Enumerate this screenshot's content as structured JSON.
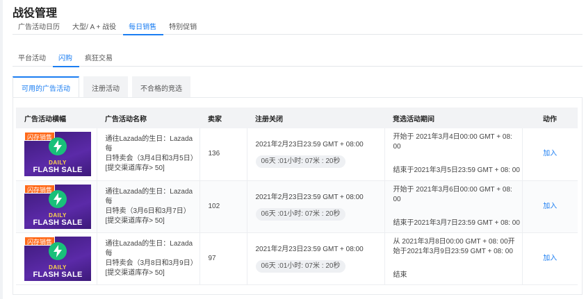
{
  "page": {
    "title": "战役管理"
  },
  "top_tabs": [
    {
      "label": "广告活动日历",
      "active": false
    },
    {
      "label": "大型/ A + 战役",
      "active": false
    },
    {
      "label": "每日销售",
      "active": true
    },
    {
      "label": "特别促销",
      "active": false
    }
  ],
  "sub_tabs": [
    {
      "label": "平台活动",
      "active": false
    },
    {
      "label": "闪购",
      "active": true
    },
    {
      "label": "疯狂交易",
      "active": false
    }
  ],
  "panel_tabs": [
    {
      "label": "可用的广告活动",
      "active": true
    },
    {
      "label": "注册活动",
      "active": false
    },
    {
      "label": "不合格的竞选",
      "active": false
    }
  ],
  "table": {
    "headers": [
      "广告活动横幅",
      "广告活动名称",
      "卖家",
      "注册关闭",
      "竞选活动期间",
      "动作"
    ],
    "banner": {
      "badge": "闪存销售",
      "line1": "DAILY",
      "line2": "FLASH SALE",
      "icon": "lightning-bolt-icon"
    },
    "rows": [
      {
        "name_l1": "通往Lazada的生日：Lazada每",
        "name_l2": "日特卖会（3月4日和3月5日）",
        "name_l3": "[提交渠道库存> 50]",
        "sellers": "136",
        "close": "2021年2月23日23:59 GMT + 08:00",
        "countdown": "06天 :01小时: 07米 : 20秒",
        "p1": "开始于 2021年3月4日00:00 GMT + 08:",
        "p2": "00",
        "p3": "结束于2021年3月5日23:59 GMT + 08:  00",
        "action": "加入"
      },
      {
        "name_l1": "通往Lazada的生日：Lazada每",
        "name_l2": "日特卖（3月6日和3月7日）",
        "name_l3": "[提交渠道库存> 50]",
        "sellers": "102",
        "close": "2021年2月23日23:59 GMT + 08:00",
        "countdown": "06天 :01小时: 07米 : 20秒",
        "p1": "开始于 2021年3月6日00:00 GMT + 08:",
        "p2": "00",
        "p3": "结束于2021年3月7日23:59 GMT + 08:  00",
        "action": "加入"
      },
      {
        "name_l1": "通往Lazada的生日：Lazada每",
        "name_l2": "日特卖会（3月8日和3月9日）",
        "name_l3": "[提交渠道库存> 50]",
        "sellers": "97",
        "close": "2021年2月23日23:59 GMT + 08:00",
        "countdown": "06天 :01小时: 07米 : 20秒",
        "p1": "从 2021年3月8日00:00 GMT + 08:  00开",
        "p2": "始于2021年3月9日23:59 GMT + 08:  00",
        "p3": "结束",
        "action": "加入"
      }
    ]
  },
  "colors": {
    "accent": "#1a7df2",
    "badge": "#ff6a1a",
    "banner_bg": "#5b2aa8",
    "bolt": "#19c07a"
  }
}
